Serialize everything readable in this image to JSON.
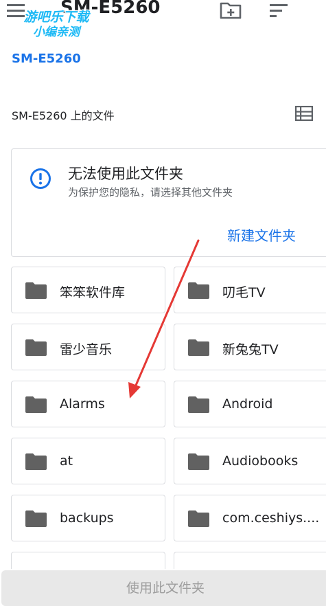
{
  "watermark": {
    "line1": "游吧乐下载",
    "line2": "小编亲测"
  },
  "appbar": {
    "title": "SM-E5260",
    "menu_icon": "menu-icon",
    "new_folder_icon": "create-new-folder-icon",
    "sort_icon": "sort-icon"
  },
  "breadcrumb": {
    "root": "SM-E5260"
  },
  "section": {
    "title": "SM-E5260 上的文件",
    "view_icon": "list-view-icon"
  },
  "notice": {
    "icon": "info-icon",
    "title": "无法使用此文件夹",
    "description": "为保护您的隐私，请选择其他文件夹",
    "action_label": "新建文件夹"
  },
  "folders": [
    {
      "name": "笨笨软件库"
    },
    {
      "name": "叨毛TV"
    },
    {
      "name": "雷少音乐"
    },
    {
      "name": "新兔兔TV"
    },
    {
      "name": "Alarms"
    },
    {
      "name": "Android"
    },
    {
      "name": "at"
    },
    {
      "name": "Audiobooks"
    },
    {
      "name": "backups"
    },
    {
      "name": "com.ceshiys...."
    }
  ],
  "bottom": {
    "use_folder_label": "使用此文件夹"
  },
  "colors": {
    "accent": "#1a73e8",
    "annotation": "#e53935",
    "folder_icon": "#616161"
  }
}
